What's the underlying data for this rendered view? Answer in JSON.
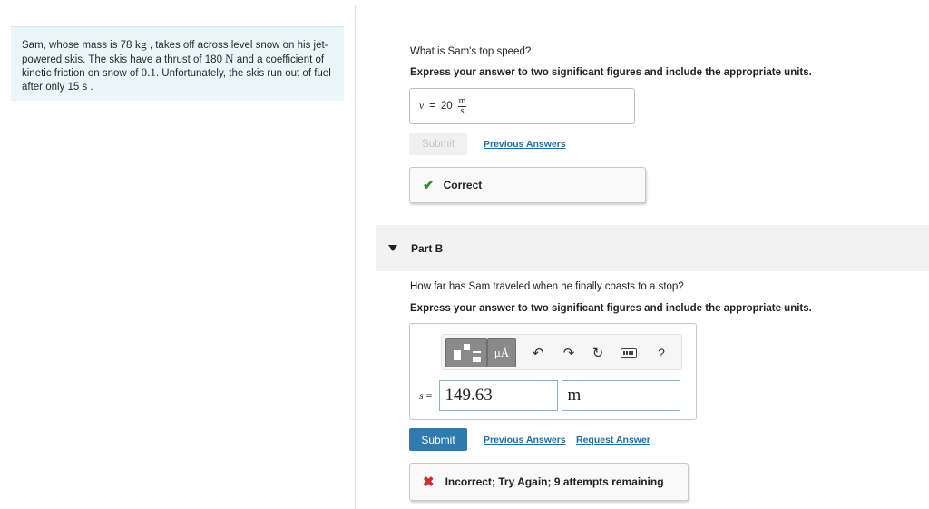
{
  "problem": {
    "t1": "Sam, whose mass is 78 ",
    "m1": "kg",
    "t2": " , takes off across level snow on his jet-powered skis. The skis have a thrust of 180 ",
    "m2": "N",
    "t3": " and a coefficient of kinetic friction on snow of ",
    "m3": "0.1",
    "t4": ". Unfortunately, the skis run out of fuel after only 15 ",
    "t5": "s",
    "t6": " ."
  },
  "partA": {
    "question": "What is Sam's top speed?",
    "instruction": "Express your answer to two significant figures and include the appropriate units.",
    "answer_var": "v",
    "answer_eq": "=",
    "answer_value": "20",
    "unit_num": "m",
    "unit_den": "s",
    "submit_label": "Submit",
    "prev_answers_label": "Previous Answers",
    "feedback_icon": "check-icon",
    "feedback_text": "Correct"
  },
  "partB": {
    "label": "Part B",
    "question": "How far has Sam traveled when he finally coasts to a stop?",
    "instruction": "Express your answer to two significant figures and include the appropriate units.",
    "toolbar": {
      "mu_label": "μÅ",
      "help_label": "?"
    },
    "answer_var": "s",
    "answer_eq": "=",
    "value": "149.63",
    "unit": "m",
    "submit_label": "Submit",
    "prev_answers_label": "Previous Answers",
    "request_answer_label": "Request Answer",
    "feedback_icon": "cross-icon",
    "feedback_text": "Incorrect; Try Again; 9 attempts remaining"
  },
  "colors": {
    "problem_bg": "#eaf6f8",
    "link": "#1e6fa5",
    "submit_bg": "#2f7bb0",
    "correct": "#2e8b2e",
    "incorrect": "#d22a2a"
  }
}
